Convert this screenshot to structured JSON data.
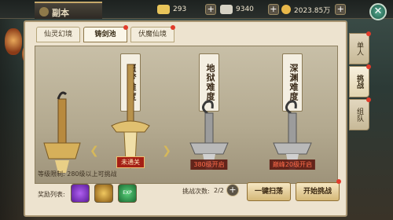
{
  "header": {
    "title": "副本",
    "resources": [
      {
        "value": "293",
        "icon": "gold-ingot-icon",
        "color": "#e8c45a"
      },
      {
        "value": "9340",
        "icon": "silver-ingot-icon",
        "color": "#d6d2c4"
      },
      {
        "value": "2023.85万",
        "icon": "coin-icon",
        "color": "#e8b84a"
      }
    ]
  },
  "tabs": [
    {
      "label": "仙灵幻境",
      "active": false
    },
    {
      "label": "铸剑池",
      "active": true
    },
    {
      "label": "伏魔仙境",
      "active": false
    }
  ],
  "cards": [
    {
      "name": "",
      "status": "",
      "locked": false
    },
    {
      "name": "噩梦难度",
      "status": "未通关",
      "locked": false,
      "selected": true
    },
    {
      "name": "地狱难度",
      "status": "380级开启",
      "locked": true
    },
    {
      "name": "深渊难度",
      "status": "巅峰20级开启",
      "locked": true
    }
  ],
  "side_tabs": [
    {
      "label": "单人",
      "active": false
    },
    {
      "label": "挑战",
      "active": true
    },
    {
      "label": "组队",
      "active": false
    }
  ],
  "footer": {
    "level_limit": "等级限制: 280级以上可挑战",
    "reward_label": "奖励列表:",
    "rewards": [
      {
        "icon": "purple-gem-icon",
        "color": "#7a2fb8"
      },
      {
        "icon": "gold-coin-stack-icon",
        "color": "#c89a2a"
      },
      {
        "icon": "exp-orb-icon",
        "color": "#2f9e4a"
      }
    ],
    "challenge_count_label": "挑战次数:",
    "challenge_count": "2/2",
    "sweep_button": "一键扫荡",
    "start_button": "开始挑战"
  }
}
